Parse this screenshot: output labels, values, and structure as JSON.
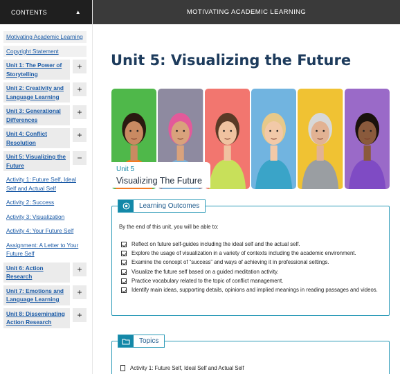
{
  "sidebar": {
    "header_label": "CONTENTS",
    "collapse_glyph": "▲",
    "items": [
      {
        "label": "Motivating Academic Learning",
        "style": "plain"
      },
      {
        "label": "Copyright Statement",
        "style": "plain"
      },
      {
        "label": "Unit 1: The Power of Storytelling",
        "style": "bold",
        "toggle": "+"
      },
      {
        "label": "Unit 2: Creativity and Language Learning",
        "style": "bold",
        "toggle": "+"
      },
      {
        "label": "Unit 3: Generational Differences",
        "style": "bold",
        "toggle": "+"
      },
      {
        "label": "Unit 4: Conflict Resolution",
        "style": "bold",
        "toggle": "+"
      },
      {
        "label": "Unit 5: Visualizing the Future",
        "style": "bold",
        "toggle": "−"
      },
      {
        "label": "Activity 1: Future Self, Ideal Self and Actual Self",
        "style": "sub"
      },
      {
        "label": "Activity 2: Success",
        "style": "sub"
      },
      {
        "label": "Activity 3: Visualization",
        "style": "sub"
      },
      {
        "label": "Activity 4: Your Future Self",
        "style": "sub"
      },
      {
        "label": "Assignment: A Letter to Your Future Self",
        "style": "sub"
      },
      {
        "label": "Unit 6: Action Research",
        "style": "bold",
        "toggle": "+"
      },
      {
        "label": "Unit 7: Emotions and Language Learning",
        "style": "bold",
        "toggle": "+"
      },
      {
        "label": "Unit 8: Disseminating Action Research",
        "style": "bold",
        "toggle": "+"
      }
    ]
  },
  "topbar": {
    "title": "MOTIVATING ACADEMIC LEARNING"
  },
  "main": {
    "title": "Unit 5: Visualizing the Future",
    "hero": {
      "unit_label": "Unit 5",
      "unit_subtitle": "Visualizing The Future",
      "portraits": [
        {
          "bg": "#4fb84a",
          "shirt": "#f47a20",
          "skin": "#c98a62",
          "hair": "#2a1a10"
        },
        {
          "bg": "#8e8aa0",
          "shirt": "#7fb1d6",
          "skin": "#d9a27c",
          "hair": "#e35a9a"
        },
        {
          "bg": "#f2766f",
          "shirt": "#c8e05a",
          "skin": "#f0c2a0",
          "hair": "#5a3a26"
        },
        {
          "bg": "#71b4e0",
          "shirt": "#3aa4c8",
          "skin": "#f2c9a8",
          "hair": "#e7c98a"
        },
        {
          "bg": "#f0c233",
          "shirt": "#9a9ea2",
          "skin": "#e2b293",
          "hair": "#d8d8d8"
        },
        {
          "bg": "#9a6ac8",
          "shirt": "#7f4bc4",
          "skin": "#8a5a3c",
          "hair": "#1a120c"
        }
      ]
    },
    "learning_outcomes": {
      "title": "Learning Outcomes",
      "intro": "By the end of this unit, you will be able to:",
      "items": [
        "Reflect on future self-guides including the ideal self and the actual self.",
        "Explore the usage of visualization in a variety of contexts including the academic environment.",
        "Examine the concept of “success” and ways of achieving it in professional settings.",
        "Visualize the future self based on a guided meditation activity.",
        "Practice vocabulary related to the topic of conflict management.",
        "Identify main ideas, supporting details, opinions and implied meanings in reading passages and videos."
      ]
    },
    "topics": {
      "title": "Topics",
      "items": [
        "Activity 1: Future Self, Ideal Self and Actual Self"
      ]
    }
  },
  "colors": {
    "accent": "#1488a8",
    "title": "#1d3b5c",
    "link": "#1a5aa6"
  }
}
